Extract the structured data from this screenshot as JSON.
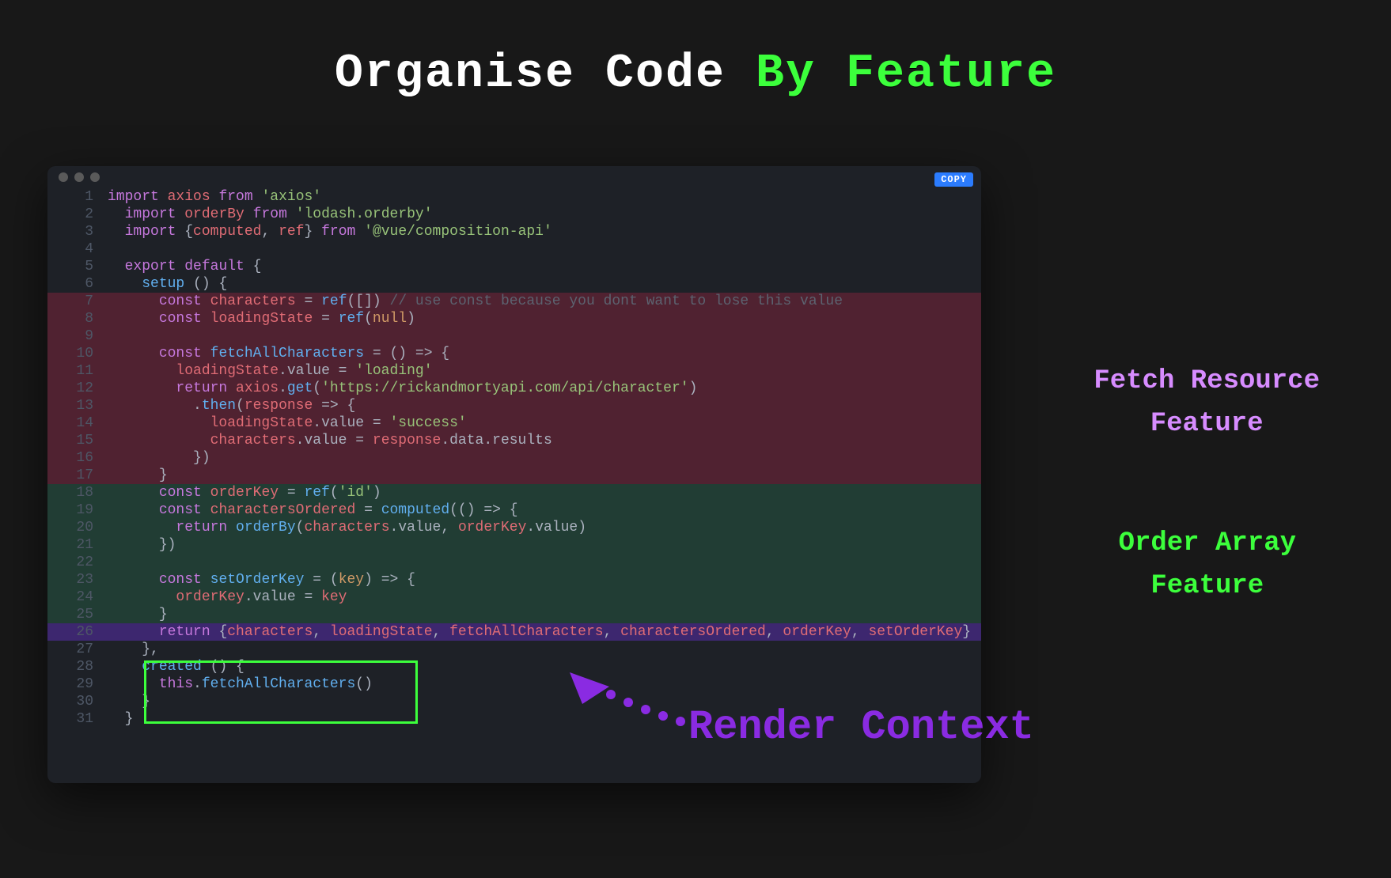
{
  "title": {
    "part1": "Organise Code ",
    "part2": "By Feature"
  },
  "copy_label": "COPY",
  "side_labels": {
    "fetch_line1": "Fetch Resource",
    "fetch_line2": "Feature",
    "order_line1": "Order Array",
    "order_line2": "Feature"
  },
  "render_context_label": "Render Context",
  "code_lines": [
    {
      "n": 1,
      "tokens": [
        [
          "k-import",
          "import"
        ],
        [
          "plain",
          " "
        ],
        [
          "ident",
          "axios"
        ],
        [
          "plain",
          " "
        ],
        [
          "k-from",
          "from"
        ],
        [
          "plain",
          " "
        ],
        [
          "str",
          "'axios'"
        ]
      ]
    },
    {
      "n": 2,
      "tokens": [
        [
          "plain",
          "  "
        ],
        [
          "k-import",
          "import"
        ],
        [
          "plain",
          " "
        ],
        [
          "ident",
          "orderBy"
        ],
        [
          "plain",
          " "
        ],
        [
          "k-from",
          "from"
        ],
        [
          "plain",
          " "
        ],
        [
          "str",
          "'lodash.orderby'"
        ]
      ]
    },
    {
      "n": 3,
      "tokens": [
        [
          "plain",
          "  "
        ],
        [
          "k-import",
          "import"
        ],
        [
          "plain",
          " "
        ],
        [
          "punct",
          "{"
        ],
        [
          "ident",
          "computed"
        ],
        [
          "punct",
          ", "
        ],
        [
          "ident",
          "ref"
        ],
        [
          "punct",
          "}"
        ],
        [
          "plain",
          " "
        ],
        [
          "k-from",
          "from"
        ],
        [
          "plain",
          " "
        ],
        [
          "str",
          "'@vue/composition-api'"
        ]
      ]
    },
    {
      "n": 4,
      "tokens": [
        [
          "plain",
          ""
        ]
      ]
    },
    {
      "n": 5,
      "tokens": [
        [
          "plain",
          "  "
        ],
        [
          "k-export",
          "export"
        ],
        [
          "plain",
          " "
        ],
        [
          "k-default",
          "default"
        ],
        [
          "plain",
          " "
        ],
        [
          "punct",
          "{"
        ]
      ]
    },
    {
      "n": 6,
      "tokens": [
        [
          "plain",
          "    "
        ],
        [
          "fn",
          "setup"
        ],
        [
          "plain",
          " "
        ],
        [
          "punct",
          "() {"
        ]
      ]
    },
    {
      "n": 7,
      "hl": "hl-fetch",
      "tokens": [
        [
          "plain",
          "      "
        ],
        [
          "k-const",
          "const"
        ],
        [
          "plain",
          " "
        ],
        [
          "ident",
          "characters"
        ],
        [
          "plain",
          " "
        ],
        [
          "punct",
          "= "
        ],
        [
          "fn",
          "ref"
        ],
        [
          "punct",
          "([])"
        ],
        [
          "plain",
          " "
        ],
        [
          "comment",
          "// use const because you dont want to lose this value"
        ]
      ]
    },
    {
      "n": 8,
      "hl": "hl-fetch",
      "tokens": [
        [
          "plain",
          "      "
        ],
        [
          "k-const",
          "const"
        ],
        [
          "plain",
          " "
        ],
        [
          "ident",
          "loadingState"
        ],
        [
          "plain",
          " "
        ],
        [
          "punct",
          "= "
        ],
        [
          "fn",
          "ref"
        ],
        [
          "punct",
          "("
        ],
        [
          "null",
          "null"
        ],
        [
          "punct",
          ")"
        ]
      ]
    },
    {
      "n": 9,
      "hl": "hl-fetch",
      "tokens": [
        [
          "plain",
          ""
        ]
      ]
    },
    {
      "n": 10,
      "hl": "hl-fetch",
      "tokens": [
        [
          "plain",
          "      "
        ],
        [
          "k-const",
          "const"
        ],
        [
          "plain",
          " "
        ],
        [
          "fn",
          "fetchAllCharacters"
        ],
        [
          "plain",
          " "
        ],
        [
          "punct",
          "= () => {"
        ]
      ]
    },
    {
      "n": 11,
      "hl": "hl-fetch",
      "tokens": [
        [
          "plain",
          "        "
        ],
        [
          "ident",
          "loadingState"
        ],
        [
          "punct",
          "."
        ],
        [
          "prop",
          "value"
        ],
        [
          "punct",
          " = "
        ],
        [
          "str",
          "'loading'"
        ]
      ]
    },
    {
      "n": 12,
      "hl": "hl-fetch",
      "tokens": [
        [
          "plain",
          "        "
        ],
        [
          "k-return",
          "return"
        ],
        [
          "plain",
          " "
        ],
        [
          "ident",
          "axios"
        ],
        [
          "punct",
          "."
        ],
        [
          "fn",
          "get"
        ],
        [
          "punct",
          "("
        ],
        [
          "str",
          "'https://rickandmortyapi.com/api/character'"
        ],
        [
          "punct",
          ")"
        ]
      ]
    },
    {
      "n": 13,
      "hl": "hl-fetch",
      "tokens": [
        [
          "plain",
          "          "
        ],
        [
          "punct",
          "."
        ],
        [
          "fn",
          "then"
        ],
        [
          "punct",
          "("
        ],
        [
          "ident",
          "response"
        ],
        [
          "plain",
          " "
        ],
        [
          "punct",
          "=> {"
        ]
      ]
    },
    {
      "n": 14,
      "hl": "hl-fetch",
      "tokens": [
        [
          "plain",
          "            "
        ],
        [
          "ident",
          "loadingState"
        ],
        [
          "punct",
          "."
        ],
        [
          "prop",
          "value"
        ],
        [
          "punct",
          " = "
        ],
        [
          "str",
          "'success'"
        ]
      ]
    },
    {
      "n": 15,
      "hl": "hl-fetch",
      "tokens": [
        [
          "plain",
          "            "
        ],
        [
          "ident",
          "characters"
        ],
        [
          "punct",
          "."
        ],
        [
          "prop",
          "value"
        ],
        [
          "punct",
          " = "
        ],
        [
          "ident",
          "response"
        ],
        [
          "punct",
          "."
        ],
        [
          "prop",
          "data"
        ],
        [
          "punct",
          "."
        ],
        [
          "prop",
          "results"
        ]
      ]
    },
    {
      "n": 16,
      "hl": "hl-fetch",
      "tokens": [
        [
          "plain",
          "          "
        ],
        [
          "punct",
          "})"
        ]
      ]
    },
    {
      "n": 17,
      "hl": "hl-fetch",
      "tokens": [
        [
          "plain",
          "      "
        ],
        [
          "punct",
          "}"
        ]
      ]
    },
    {
      "n": 18,
      "hl": "hl-order",
      "tokens": [
        [
          "plain",
          "      "
        ],
        [
          "k-const",
          "const"
        ],
        [
          "plain",
          " "
        ],
        [
          "ident",
          "orderKey"
        ],
        [
          "plain",
          " "
        ],
        [
          "punct",
          "= "
        ],
        [
          "fn",
          "ref"
        ],
        [
          "punct",
          "("
        ],
        [
          "str",
          "'id'"
        ],
        [
          "punct",
          ")"
        ]
      ]
    },
    {
      "n": 19,
      "hl": "hl-order",
      "tokens": [
        [
          "plain",
          "      "
        ],
        [
          "k-const",
          "const"
        ],
        [
          "plain",
          " "
        ],
        [
          "ident",
          "charactersOrdered"
        ],
        [
          "plain",
          " "
        ],
        [
          "punct",
          "= "
        ],
        [
          "fn",
          "computed"
        ],
        [
          "punct",
          "(() => {"
        ]
      ]
    },
    {
      "n": 20,
      "hl": "hl-order",
      "tokens": [
        [
          "plain",
          "        "
        ],
        [
          "k-return",
          "return"
        ],
        [
          "plain",
          " "
        ],
        [
          "fn",
          "orderBy"
        ],
        [
          "punct",
          "("
        ],
        [
          "ident",
          "characters"
        ],
        [
          "punct",
          "."
        ],
        [
          "prop",
          "value"
        ],
        [
          "punct",
          ", "
        ],
        [
          "ident",
          "orderKey"
        ],
        [
          "punct",
          "."
        ],
        [
          "prop",
          "value"
        ],
        [
          "punct",
          ")"
        ]
      ]
    },
    {
      "n": 21,
      "hl": "hl-order",
      "tokens": [
        [
          "plain",
          "      "
        ],
        [
          "punct",
          "})"
        ]
      ]
    },
    {
      "n": 22,
      "hl": "hl-order",
      "tokens": [
        [
          "plain",
          ""
        ]
      ]
    },
    {
      "n": 23,
      "hl": "hl-order",
      "tokens": [
        [
          "plain",
          "      "
        ],
        [
          "k-const",
          "const"
        ],
        [
          "plain",
          " "
        ],
        [
          "fn",
          "setOrderKey"
        ],
        [
          "plain",
          " "
        ],
        [
          "punct",
          "= ("
        ],
        [
          "attr",
          "key"
        ],
        [
          "punct",
          ") => {"
        ]
      ]
    },
    {
      "n": 24,
      "hl": "hl-order",
      "tokens": [
        [
          "plain",
          "        "
        ],
        [
          "ident",
          "orderKey"
        ],
        [
          "punct",
          "."
        ],
        [
          "prop",
          "value"
        ],
        [
          "punct",
          " = "
        ],
        [
          "ident",
          "key"
        ]
      ]
    },
    {
      "n": 25,
      "hl": "hl-order",
      "tokens": [
        [
          "plain",
          "      "
        ],
        [
          "punct",
          "}"
        ]
      ]
    },
    {
      "n": 26,
      "hl": "hl-return",
      "tokens": [
        [
          "plain",
          "      "
        ],
        [
          "k-return",
          "return"
        ],
        [
          "plain",
          " "
        ],
        [
          "punct",
          "{"
        ],
        [
          "ident",
          "characters"
        ],
        [
          "punct",
          ", "
        ],
        [
          "ident",
          "loadingState"
        ],
        [
          "punct",
          ", "
        ],
        [
          "ident",
          "fetchAllCharacters"
        ],
        [
          "punct",
          ", "
        ],
        [
          "ident",
          "charactersOrdered"
        ],
        [
          "punct",
          ", "
        ],
        [
          "ident",
          "orderKey"
        ],
        [
          "punct",
          ", "
        ],
        [
          "ident",
          "setOrderKey"
        ],
        [
          "punct",
          "}"
        ]
      ]
    },
    {
      "n": 27,
      "tokens": [
        [
          "plain",
          "    "
        ],
        [
          "punct",
          "},"
        ]
      ]
    },
    {
      "n": 28,
      "tokens": [
        [
          "plain",
          "    "
        ],
        [
          "fn",
          "created"
        ],
        [
          "plain",
          " "
        ],
        [
          "punct",
          "() {"
        ]
      ]
    },
    {
      "n": 29,
      "tokens": [
        [
          "plain",
          "      "
        ],
        [
          "k-this",
          "this"
        ],
        [
          "punct",
          "."
        ],
        [
          "fn",
          "fetchAllCharacters"
        ],
        [
          "punct",
          "()"
        ]
      ]
    },
    {
      "n": 30,
      "tokens": [
        [
          "plain",
          "    "
        ],
        [
          "punct",
          "}"
        ]
      ]
    },
    {
      "n": 31,
      "tokens": [
        [
          "plain",
          "  "
        ],
        [
          "punct",
          "}"
        ]
      ]
    }
  ]
}
